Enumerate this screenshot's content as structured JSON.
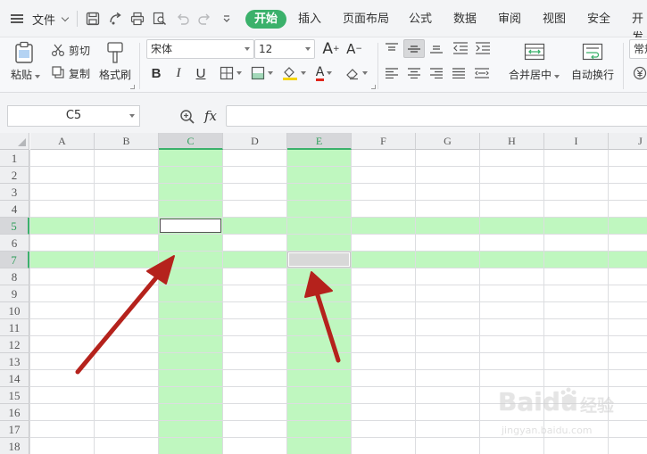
{
  "menubar": {
    "file_label": "文件",
    "tabs": [
      "开始",
      "插入",
      "页面布局",
      "公式",
      "数据",
      "审阅",
      "视图",
      "安全",
      "开发"
    ]
  },
  "ribbon": {
    "paste": "粘贴",
    "cut": "剪切",
    "copy": "复制",
    "format_painter": "格式刷",
    "font_name": "宋体",
    "font_size": "12",
    "bold": "B",
    "italic": "I",
    "underline": "U",
    "font_color_glyph": "A",
    "grow_font": "A",
    "shrink_font": "A",
    "merge_center": "合并居中",
    "wrap_text": "自动换行",
    "number_format": "常规"
  },
  "formula_bar": {
    "cell_ref": "C5",
    "fx": "fx",
    "formula": ""
  },
  "grid": {
    "columns": [
      "A",
      "B",
      "C",
      "D",
      "E",
      "F",
      "G",
      "H",
      "I",
      "J"
    ],
    "rows": [
      "1",
      "2",
      "3",
      "4",
      "5",
      "6",
      "7",
      "8",
      "9",
      "10",
      "11",
      "12",
      "13",
      "14",
      "15",
      "16",
      "17",
      "18"
    ],
    "highlighted_columns": [
      "C",
      "E"
    ],
    "highlighted_rows": [
      "5",
      "7"
    ],
    "active_cell": "C5",
    "selected_cell": "E7",
    "highlight_color": "#bff7bf"
  },
  "annotations": {
    "arrow_color": "#b5221c",
    "arrows": [
      "arrow-to-c7",
      "arrow-to-e8"
    ]
  },
  "watermark": {
    "brand": "Baidu",
    "cn": "经验",
    "url": "jingyan.baidu.com"
  },
  "colors": {
    "accent": "#3bb16b",
    "menubar_bg": "#f3f4f6",
    "ribbon_bg": "#f7f8fa"
  }
}
